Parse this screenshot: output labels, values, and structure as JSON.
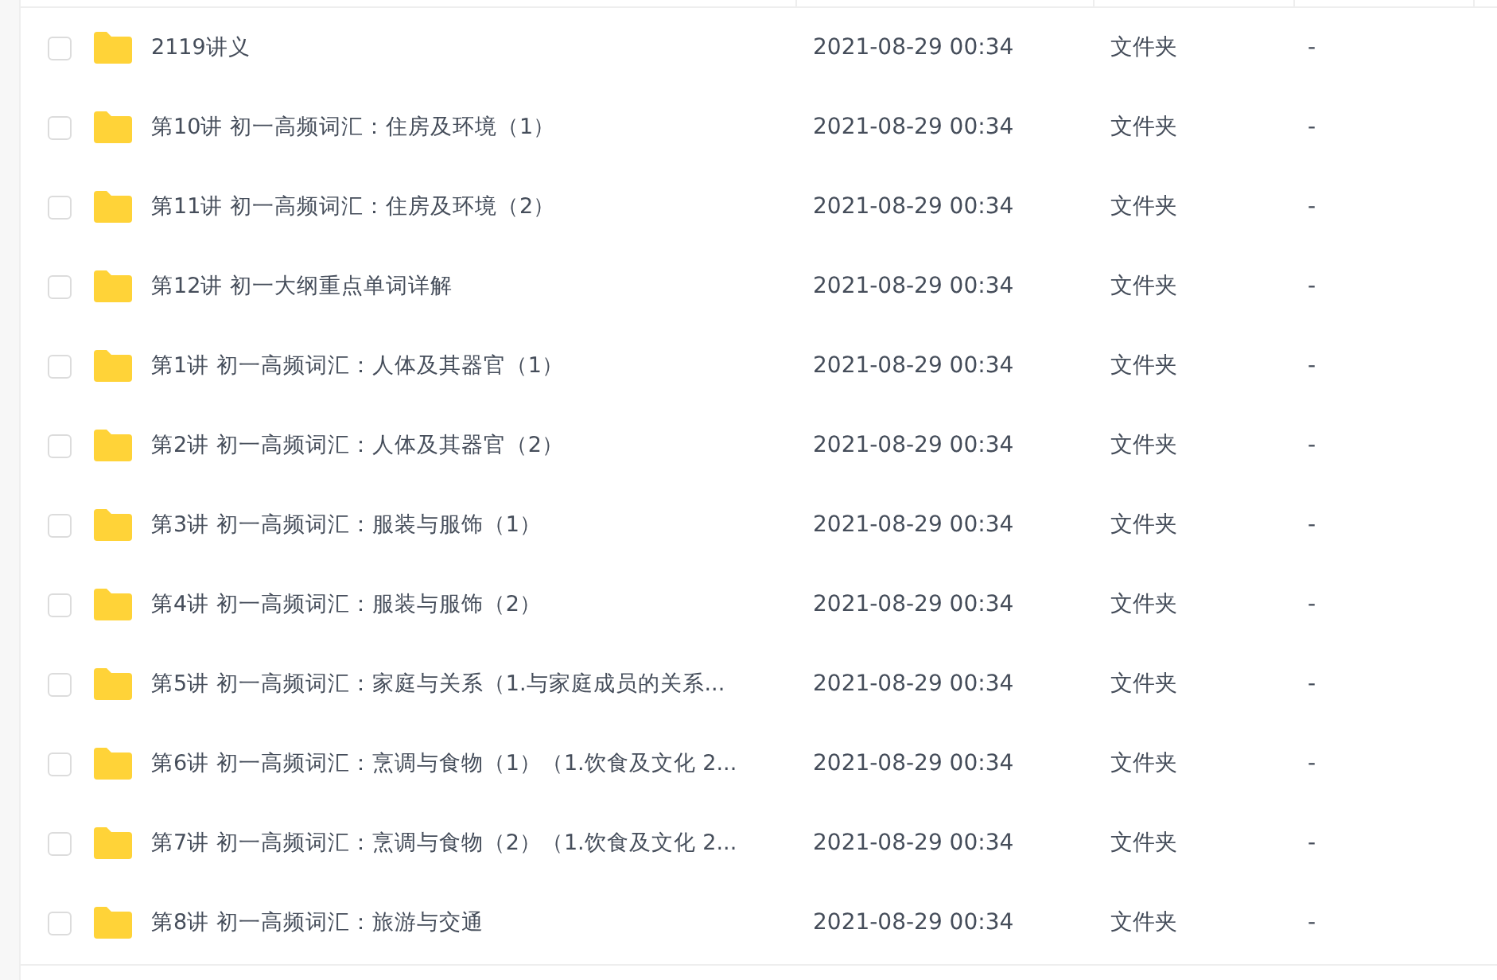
{
  "files": [
    {
      "name": "2119讲义",
      "modified": "2021-08-29 00:34",
      "type": "文件夹",
      "size": "-",
      "checked": false
    },
    {
      "name": "第10讲 初一高频词汇：住房及环境（1）",
      "modified": "2021-08-29 00:34",
      "type": "文件夹",
      "size": "-",
      "checked": false
    },
    {
      "name": "第11讲 初一高频词汇：住房及环境（2）",
      "modified": "2021-08-29 00:34",
      "type": "文件夹",
      "size": "-",
      "checked": false
    },
    {
      "name": "第12讲 初一大纲重点单词详解",
      "modified": "2021-08-29 00:34",
      "type": "文件夹",
      "size": "-",
      "checked": false
    },
    {
      "name": "第1讲 初一高频词汇：人体及其器官（1）",
      "modified": "2021-08-29 00:34",
      "type": "文件夹",
      "size": "-",
      "checked": false
    },
    {
      "name": "第2讲 初一高频词汇：人体及其器官（2）",
      "modified": "2021-08-29 00:34",
      "type": "文件夹",
      "size": "-",
      "checked": false
    },
    {
      "name": "第3讲 初一高频词汇：服装与服饰（1）",
      "modified": "2021-08-29 00:34",
      "type": "文件夹",
      "size": "-",
      "checked": false
    },
    {
      "name": "第4讲 初一高频词汇：服装与服饰（2）",
      "modified": "2021-08-29 00:34",
      "type": "文件夹",
      "size": "-",
      "checked": false
    },
    {
      "name": "第5讲 初一高频词汇：家庭与关系（1.与家庭成员的关系...",
      "modified": "2021-08-29 00:34",
      "type": "文件夹",
      "size": "-",
      "checked": false
    },
    {
      "name": "第6讲 初一高频词汇：烹调与食物（1）（1.饮食及文化 2...",
      "modified": "2021-08-29 00:34",
      "type": "文件夹",
      "size": "-",
      "checked": false
    },
    {
      "name": "第7讲 初一高频词汇：烹调与食物（2）（1.饮食及文化 2...",
      "modified": "2021-08-29 00:34",
      "type": "文件夹",
      "size": "-",
      "checked": false
    },
    {
      "name": "第8讲 初一高频词汇：旅游与交通",
      "modified": "2021-08-29 00:34",
      "type": "文件夹",
      "size": "-",
      "checked": false
    }
  ]
}
